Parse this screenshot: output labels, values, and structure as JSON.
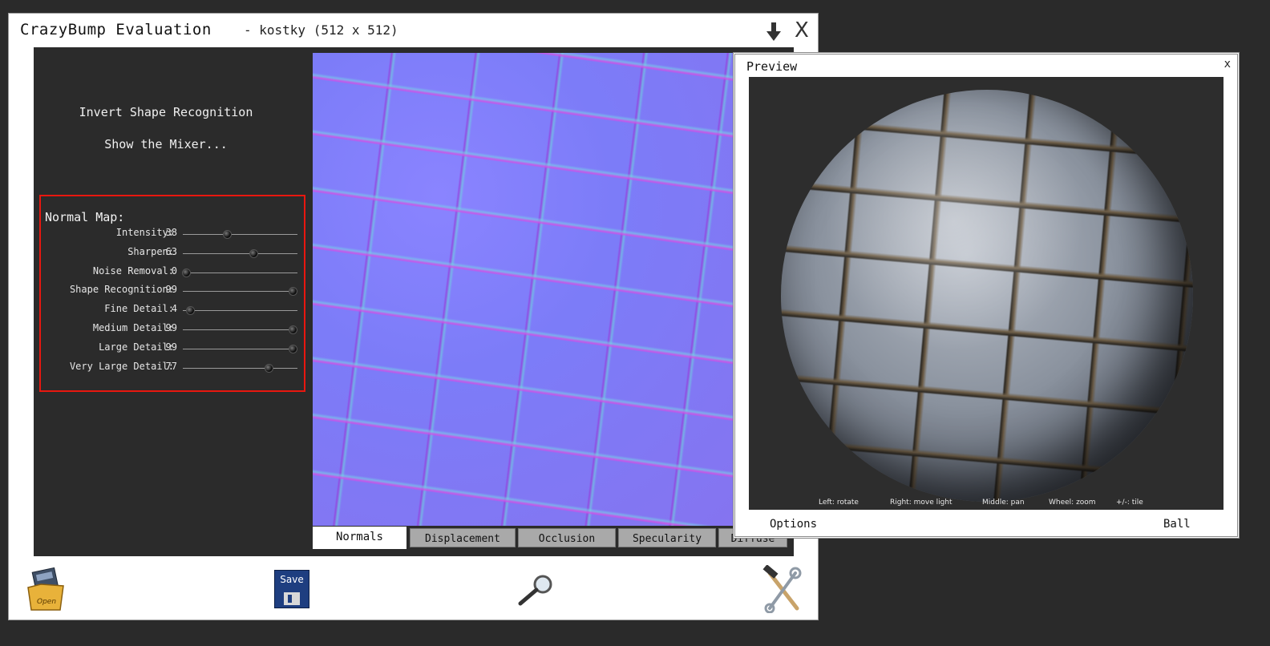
{
  "window": {
    "app_title": "CrazyBump Evaluation",
    "file_info": "- kostky (512 x 512)"
  },
  "menu": {
    "invert_shape": "Invert Shape Recognition",
    "show_mixer": "Show the Mixer..."
  },
  "normal_map": {
    "title": "Normal Map:",
    "sliders": [
      {
        "label": "Intensity:",
        "value": "38",
        "level": 38
      },
      {
        "label": "Sharpen:",
        "value": "63",
        "level": 63
      },
      {
        "label": "Noise Removal:",
        "value": "0",
        "level": 0
      },
      {
        "label": "Shape Recognition:",
        "value": "99",
        "level": 99
      },
      {
        "label": "Fine Detail:",
        "value": "4",
        "level": 4
      },
      {
        "label": "Medium Detail:",
        "value": "99",
        "level": 99
      },
      {
        "label": "Large Detail:",
        "value": "99",
        "level": 99
      },
      {
        "label": "Very Large Detail:",
        "value": "77",
        "level": 77
      }
    ],
    "accent_color": "#e8170f"
  },
  "tabs": [
    {
      "label": "Normals",
      "active": true
    },
    {
      "label": "Displacement",
      "active": false
    },
    {
      "label": "Occlusion",
      "active": false
    },
    {
      "label": "Specularity",
      "active": false
    },
    {
      "label": "Diffuse",
      "active": false
    }
  ],
  "toolbar": {
    "open_label": "Open",
    "save_label": "Save",
    "icons": [
      "open-folder-icon",
      "save-disk-icon",
      "magnify-icon",
      "tools-icon"
    ]
  },
  "preview": {
    "title": "Preview",
    "close": "x",
    "hints": {
      "left": "Left: rotate",
      "right": "Right: move light",
      "middle": "Middle: pan",
      "wheel": "Wheel: zoom",
      "tile": "+/-: tile"
    },
    "options": "Options",
    "shape": "Ball"
  }
}
